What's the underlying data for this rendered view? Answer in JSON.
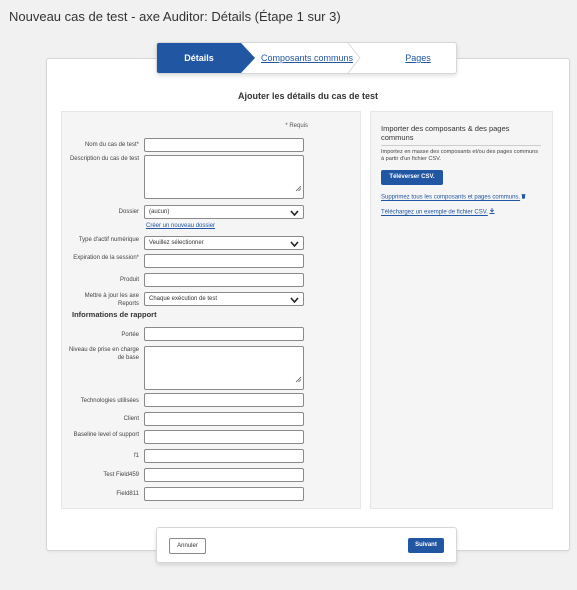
{
  "page": {
    "title": "Nouveau cas de test - axe Auditor: Détails (Étape 1 sur 3)"
  },
  "stepper": {
    "steps": [
      {
        "label": "Détails",
        "active": true
      },
      {
        "label": "Composants communs",
        "active": false
      },
      {
        "label": "Pages",
        "active": false
      }
    ]
  },
  "form": {
    "heading": "Ajouter les détails du cas de test",
    "required_note": "* Requis",
    "fields": {
      "name": {
        "label": "Nom du cas de test*",
        "value": ""
      },
      "description": {
        "label": "Description du cas de test",
        "value": ""
      },
      "folder": {
        "label": "Dossier",
        "value": "(aucun)"
      },
      "new_folder_link": "Créer un nouveau dossier",
      "asset_type": {
        "label": "Type d'actif numérique",
        "value": "Veuillez sélectionner"
      },
      "session_expiry": {
        "label": "Expiration de la session*",
        "value": ""
      },
      "product": {
        "label": "Produit",
        "value": ""
      },
      "reports_update": {
        "label": "Mettre à jour les axe Reports",
        "value": "Chaque exécution de test"
      }
    },
    "report_section": {
      "title": "Informations de rapport",
      "fields": {
        "scope": {
          "label": "Portée",
          "value": ""
        },
        "base_support": {
          "label": "Niveau de prise en charge de base",
          "value": ""
        },
        "technologies": {
          "label": "Technologies utilisées",
          "value": ""
        },
        "client": {
          "label": "Client",
          "value": ""
        },
        "baseline": {
          "label": "Baseline level of support",
          "value": ""
        },
        "f1": {
          "label": "f1",
          "value": ""
        },
        "test_field459": {
          "label": "Test Field459",
          "value": ""
        },
        "field811": {
          "label": "Field811",
          "value": ""
        }
      }
    }
  },
  "import": {
    "title": "Importer des composants & des pages communs",
    "description": "Importez en masse des composants et/ou des pages communs à partir d'un fichier CSV.",
    "upload_button": "Téléverser CSV.",
    "delete_link": "Supprimez tous les composants et pages communs.",
    "download_link": "Téléchargez un exemple de fichier CSV."
  },
  "footer": {
    "cancel": "Annuler",
    "next": "Suivant"
  },
  "icons": {
    "chevron": "chevron-down-icon",
    "resize": "resize-grip-icon",
    "trash": "trash-icon",
    "download": "download-icon"
  },
  "colors": {
    "accent": "#2156a3",
    "background": "#f1f1f1",
    "panel": "#f5f5f5"
  }
}
